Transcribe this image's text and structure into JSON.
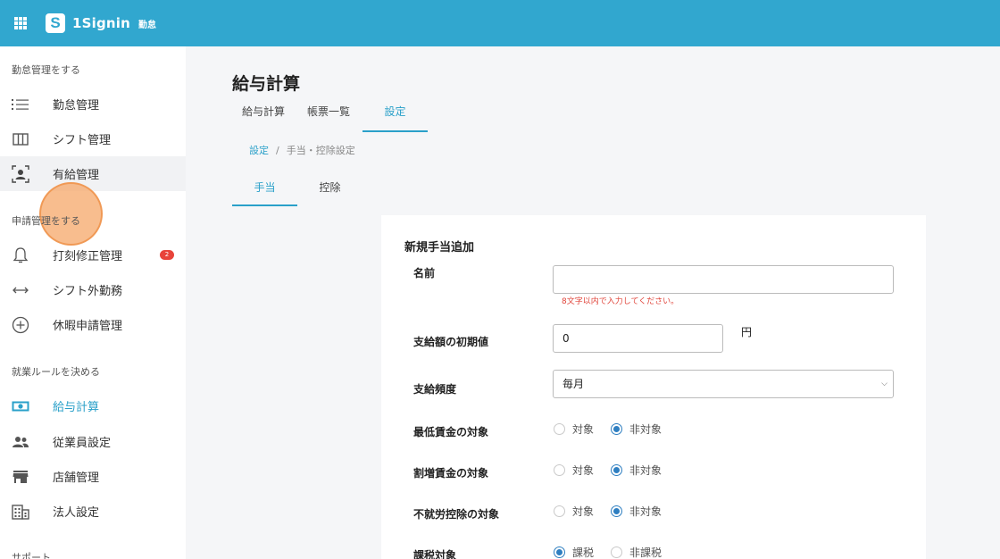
{
  "topbar": {
    "app_name": "1Signin",
    "app_sub": "勤怠",
    "logo_mark": "S",
    "menu_icon": "grid-icon",
    "color": "#31a7cf"
  },
  "sidebar": {
    "sections": [
      {
        "label": "勤怠管理をする"
      },
      {
        "label": "申請管理をする"
      },
      {
        "label": "就業ルールを決める"
      },
      {
        "label": "サポート"
      }
    ],
    "items": [
      {
        "label": "勤怠管理",
        "icon": "list-icon"
      },
      {
        "label": "シフト管理",
        "icon": "columns-icon"
      },
      {
        "label": "有給管理",
        "icon": "person-badge-icon"
      },
      {
        "label": "打刻修正管理",
        "icon": "bell-icon",
        "badge": "2"
      },
      {
        "label": "シフト外勤務",
        "icon": "left-right-arrow-icon"
      },
      {
        "label": "休暇申請管理",
        "icon": "plus-circle-icon"
      },
      {
        "label": "給与計算",
        "icon": "money-icon"
      },
      {
        "label": "従業員設定",
        "icon": "people-icon"
      },
      {
        "label": "店舗管理",
        "icon": "store-icon"
      },
      {
        "label": "法人設定",
        "icon": "building-icon"
      }
    ]
  },
  "main": {
    "title": "給与計算",
    "tabs": [
      {
        "label": "給与計算"
      },
      {
        "label": "帳票一覧"
      },
      {
        "label": "設定"
      }
    ],
    "breadcrumb": {
      "link": "設定",
      "separator": "/",
      "current": "手当・控除設定"
    },
    "subtabs": [
      {
        "label": "手当"
      },
      {
        "label": "控除"
      }
    ]
  },
  "form": {
    "title": "新規手当追加",
    "name_label": "名前",
    "name_value": "",
    "name_error": "8文字以内で入力してください。",
    "amount_label": "支給額の初期値",
    "amount_value": "0",
    "amount_unit": "円",
    "frequency_label": "支給頻度",
    "frequency_value": "毎月",
    "min_wage_label": "最低賃金の対象",
    "premium_label": "割増賃金の対象",
    "absence_label": "不就労控除の対象",
    "taxable_label": "課税対象",
    "opt_target": "対象",
    "opt_non_target": "非対象",
    "opt_taxable": "課税",
    "opt_non_taxable": "非課税"
  }
}
